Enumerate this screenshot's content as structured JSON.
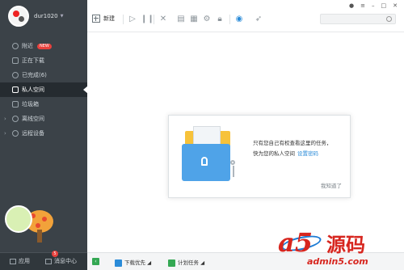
{
  "user": {
    "name": "dur1020"
  },
  "menu": [
    {
      "label": "附近",
      "badge": "NEW"
    },
    {
      "label": "正在下载"
    },
    {
      "label": "已完成(6)"
    },
    {
      "label": "私人空间",
      "active": true
    },
    {
      "label": "垃圾箱"
    },
    {
      "label": "离线空间"
    },
    {
      "label": "远程设备"
    }
  ],
  "bottom": {
    "apps_label": "应用",
    "messages_label": "消息中心",
    "messages_count": "5"
  },
  "toolbar": {
    "new_label": "新建"
  },
  "dialog": {
    "line1": "只有您自己有权查看这里的任务，",
    "line2": "快为您的私人空间",
    "link": "设置密码",
    "ok": "我知道了"
  },
  "statusbar": {
    "priority_label": "下载优先",
    "schedule_label": "计划任务"
  },
  "watermark": {
    "text1": "a5",
    "text2": "源码",
    "site": "admin5.com"
  },
  "colors": {
    "accent": "#2a8bd8",
    "sidebar": "#3b4248",
    "badge": "#e8413d"
  }
}
